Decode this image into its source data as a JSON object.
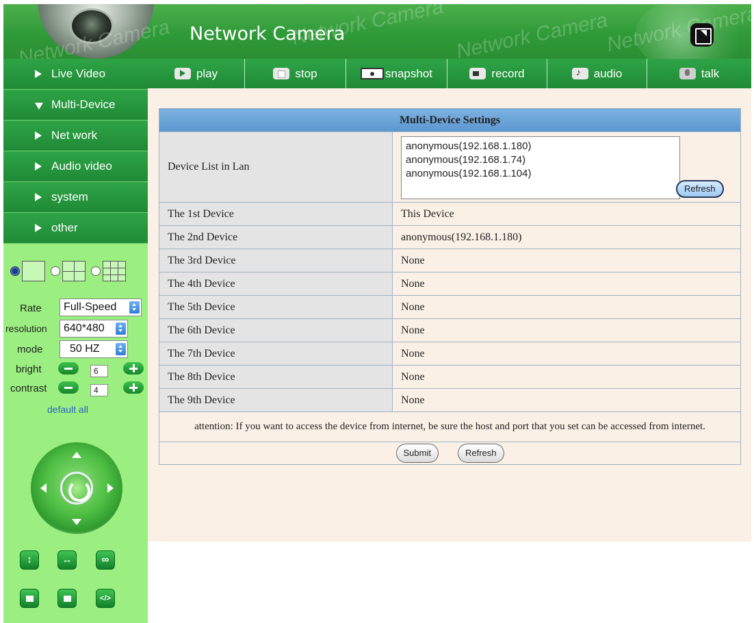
{
  "header": {
    "title": "Network Camera",
    "watermark": "Network Camera",
    "fullscreen_icon": "fullscreen-icon"
  },
  "sidebar": {
    "menu": [
      {
        "label": "Live Video",
        "expanded": false
      },
      {
        "label": "Multi-Device",
        "expanded": true
      },
      {
        "label": "Net work",
        "expanded": false
      },
      {
        "label": "Audio video",
        "expanded": false
      },
      {
        "label": "system",
        "expanded": false
      },
      {
        "label": "other",
        "expanded": false
      }
    ],
    "layout_options": [
      "1-view",
      "4-view",
      "9-view"
    ],
    "controls": {
      "rate_label": "Rate",
      "rate_value": "Full-Speed",
      "resolution_label": "resolution",
      "resolution_value": "640*480",
      "mode_label": "mode",
      "mode_value": "50 HZ",
      "bright_label": "bright",
      "bright_value": "6",
      "contrast_label": "contrast",
      "contrast_value": "4",
      "default_all": "default all"
    },
    "ptz_icons": [
      "up-arrow-icon",
      "down-arrow-icon",
      "left-arrow-icon",
      "right-arrow-icon",
      "center-icon"
    ],
    "bottom_buttons": [
      {
        "icon": "vertical-flip-icon",
        "glyph": "↕"
      },
      {
        "icon": "horizontal-flip-icon",
        "glyph": "↔"
      },
      {
        "icon": "infinite-icon",
        "glyph": "∞"
      },
      {
        "icon": "square-icon",
        "glyph": ""
      },
      {
        "icon": "square-icon",
        "glyph": ""
      },
      {
        "icon": "code-icon",
        "glyph": "</>"
      }
    ]
  },
  "toolbar": {
    "buttons": [
      {
        "label": "play",
        "icon": "play-icon"
      },
      {
        "label": "stop",
        "icon": "stop-icon"
      },
      {
        "label": "snapshot",
        "icon": "snapshot-icon"
      },
      {
        "label": "record",
        "icon": "record-icon"
      },
      {
        "label": "audio",
        "icon": "audio-icon"
      },
      {
        "label": "talk",
        "icon": "talk-icon"
      }
    ]
  },
  "settings": {
    "title": "Multi-Device Settings",
    "device_list_label": "Device List in Lan",
    "device_list": [
      "anonymous(192.168.1.180)",
      "anonymous(192.168.1.74)",
      "anonymous(192.168.1.104)"
    ],
    "list_refresh": "Refresh",
    "rows": [
      {
        "label": "The 1st Device",
        "value": "This Device",
        "link": false
      },
      {
        "label": "The 2nd Device",
        "value": "anonymous(192.168.1.180)",
        "link": true
      },
      {
        "label": "The 3rd Device",
        "value": "None",
        "link": true
      },
      {
        "label": "The 4th Device",
        "value": "None",
        "link": true
      },
      {
        "label": "The 5th Device",
        "value": "None",
        "link": true
      },
      {
        "label": "The 6th Device",
        "value": "None",
        "link": true
      },
      {
        "label": "The 7th Device",
        "value": "None",
        "link": true
      },
      {
        "label": "The 8th Device",
        "value": "None",
        "link": true
      },
      {
        "label": "The 9th Device",
        "value": "None",
        "link": true
      }
    ],
    "attention": "attention: If you want to access the device from internet, be sure the host and port that you set can be accessed from internet.",
    "submit": "Submit",
    "refresh": "Refresh"
  },
  "colors": {
    "header_green": "#2f9a38",
    "menu_green": "#1f8a36",
    "sidebar_bg": "#9bef80",
    "table_header_blue": "#5b96cf",
    "link_blue": "#3b3fa8",
    "content_bg": "#fbf0e6"
  }
}
